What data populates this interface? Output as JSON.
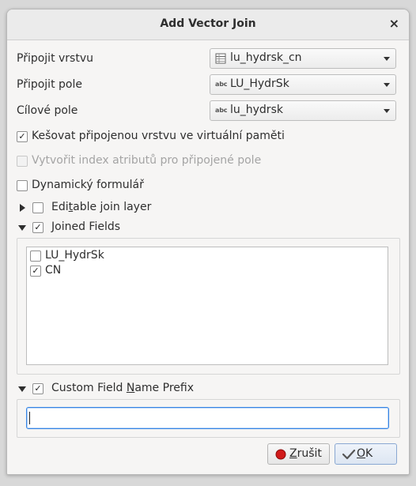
{
  "dialog": {
    "title": "Add Vector Join",
    "close_symbol": "×"
  },
  "form": {
    "join_layer": {
      "label": "Připojit vrstvu",
      "value": "lu_hydrsk_cn",
      "icon": "table-icon"
    },
    "join_field": {
      "label": "Připojit pole",
      "value": "LU_HydrSk",
      "icon_text": "abc"
    },
    "target_field": {
      "label": "Cílové pole",
      "value": "lu_hydrsk",
      "icon_text": "abc"
    }
  },
  "options": {
    "cache": {
      "label": "Kešovat připojenou vrstvu ve virtuální paměti",
      "checked": true,
      "check_glyph": "✓"
    },
    "index": {
      "label": "Vytvořit index atributů pro připojené pole",
      "checked": false,
      "enabled": false
    },
    "dynamic_form": {
      "label": "Dynamický formulář",
      "checked": false
    }
  },
  "editable_join": {
    "pre": "Edi",
    "underlined": "t",
    "post": "able join layer",
    "expanded": false,
    "checked": false
  },
  "joined_fields": {
    "pre": "",
    "underlined": "J",
    "post": "oined Fields",
    "expanded": true,
    "checked": true,
    "check_glyph": "✓",
    "items": [
      {
        "label": "LU_HydrSk",
        "checked": false,
        "check_glyph": ""
      },
      {
        "label": "CN",
        "checked": true,
        "check_glyph": "✓"
      }
    ]
  },
  "prefix": {
    "pre": "Custom Field ",
    "underlined": "N",
    "post": "ame Prefix",
    "expanded": true,
    "checked": true,
    "check_glyph": "✓",
    "value": ""
  },
  "buttons": {
    "cancel": {
      "underlined": "Z",
      "post": "rušit",
      "icon": "cancel-icon"
    },
    "ok": {
      "underlined": "O",
      "post": "K",
      "icon": "ok-icon"
    }
  },
  "colors": {
    "focus": "#3584e4",
    "cancel_icon": "#d11a1a"
  }
}
